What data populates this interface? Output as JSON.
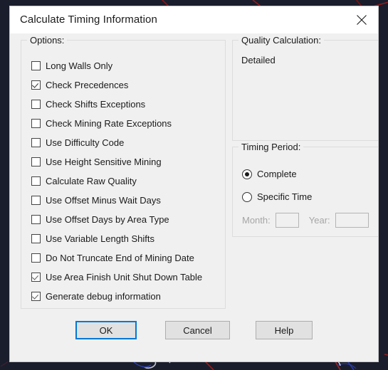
{
  "window": {
    "title": "Calculate Timing Information",
    "close_icon": "close-icon"
  },
  "options": {
    "legend": "Options:",
    "items": [
      {
        "label": "Long Walls Only",
        "checked": false
      },
      {
        "label": "Check Precedences",
        "checked": true
      },
      {
        "label": "Check Shifts Exceptions",
        "checked": false
      },
      {
        "label": "Check Mining Rate Exceptions",
        "checked": false
      },
      {
        "label": "Use Difficulty Code",
        "checked": false
      },
      {
        "label": "Use Height Sensitive Mining",
        "checked": false
      },
      {
        "label": "Calculate Raw Quality",
        "checked": false
      },
      {
        "label": "Use Offset Minus Wait Days",
        "checked": false
      },
      {
        "label": "Use Offset Days by Area Type",
        "checked": false
      },
      {
        "label": "Use Variable Length Shifts",
        "checked": false
      },
      {
        "label": "Do Not Truncate End of Mining Date",
        "checked": false
      },
      {
        "label": "Use Area Finish Unit Shut Down Table",
        "checked": true
      },
      {
        "label": "Generate debug information",
        "checked": true
      }
    ]
  },
  "quality": {
    "legend": "Quality Calculation:",
    "value": "Detailed"
  },
  "timing": {
    "legend": "Timing Period:",
    "complete_label": "Complete",
    "complete_selected": true,
    "specific_label": "Specific Time",
    "specific_selected": false,
    "month_label": "Month:",
    "month_value": "",
    "year_label": "Year:",
    "year_value": ""
  },
  "buttons": {
    "ok": "OK",
    "cancel": "Cancel",
    "help": "Help"
  },
  "colors": {
    "accent": "#0078d7",
    "dialog_bg": "#f0f0f0",
    "titlebar_bg": "#ffffff",
    "desktop_bg": "#1a1d2b",
    "disabled_text": "#a6a6a6"
  }
}
